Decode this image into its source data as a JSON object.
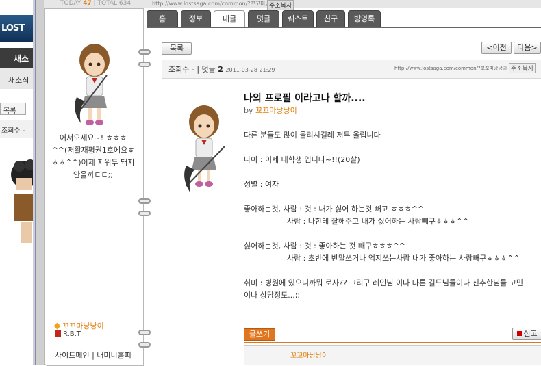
{
  "background": {
    "news_label": "새소",
    "sub_label": "새소식",
    "list_button": "목록",
    "views_label": "조회수 -"
  },
  "header": {
    "today_label": "TODAY",
    "today_count": "47",
    "total_label": "TOTAL",
    "total_count": "634",
    "url": "http://www.lostsaga.com/common/?꼬꼬마낭낭이",
    "copy_label": "주소복사"
  },
  "profile": {
    "greeting": "어서오세요~! ㅎㅎㅎ^^(저활재평권1호에요ㅎㅎㅎ^^)이제 지워두 돼지안을까ㄷㄷ;;",
    "user_name": "꼬꼬마낭낭이",
    "guild": "R.B.T",
    "links": "사이트메인 | 내미니홈피"
  },
  "tabs": [
    "홈",
    "정보",
    "내글",
    "덧글",
    "퀘스트",
    "친구",
    "방명록"
  ],
  "nav": {
    "list_button": "목록",
    "prev_button": "<이전",
    "next_button": "다음>"
  },
  "meta": {
    "views": "조회수 - | 덧글",
    "comment_count": "2",
    "date": "2011-03-28 21:29",
    "url": "http://www.lostsaga.com/common/?꼬꼬마낭낭이",
    "copy_label": "주소복사"
  },
  "post": {
    "title": "나의 프로필 이라고나 할까....",
    "by_label": "by",
    "author": "꼬꼬마낭낭이",
    "lines": [
      "다른 분들도 많이 올리시길레 저두 올립니다",
      "",
      "나이 : 이제 대학생 입니다~!!(20살)",
      "",
      "성별 : 여자",
      "",
      "좋아하는것, 사람 : 것 : 내가 싫어 하는것 빼고 ㅎㅎㅎ^^",
      "                  사람 : 나한테 잘해주고 내가 싫어하는 사람빼구ㅎㅎㅎ^^",
      "",
      "싫어하는것, 사람 : 것 : 좋아하는 것 빼구ㅎㅎㅎ^^",
      "                  사람 : 초반에 반말쓰거나 억지쓰는사람 내가 좋아하는 사람빼구ㅎㅎㅎ^^",
      "",
      "취미 : 병원에 있으니까뭐 로사?? 그리구 레인님 이나 다른 길드님들이나 친추한님들 고민",
      "이나 상담정도...;;"
    ]
  },
  "footer": {
    "write_button": "글쓰기",
    "report_button": "신고",
    "comment_author": "꼬꼬마낭낭이"
  },
  "colors": {
    "accent": "#e07a00",
    "tab_dark": "#5a5a5a",
    "write_button": "#e0751e"
  }
}
